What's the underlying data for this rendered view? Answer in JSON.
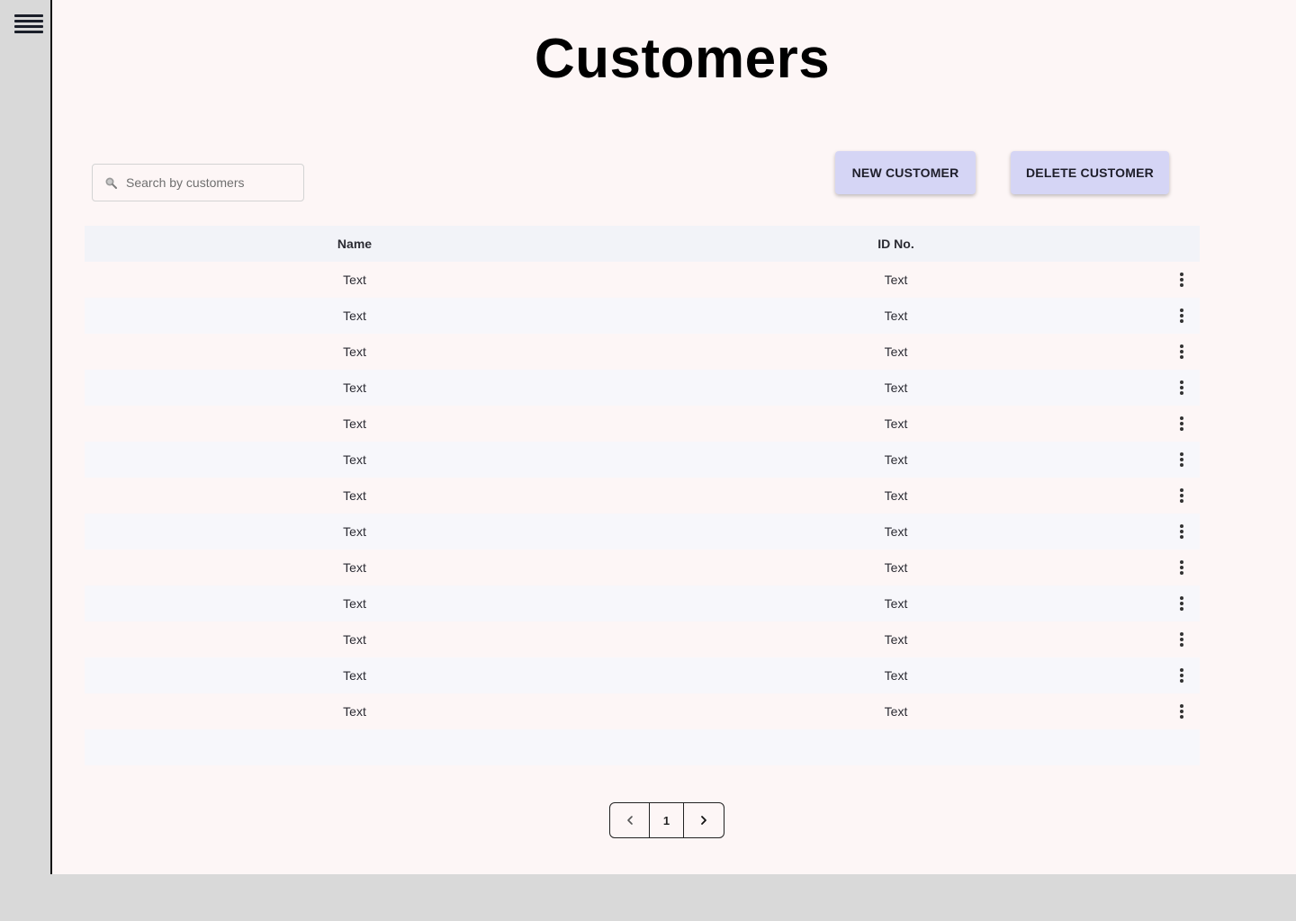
{
  "page": {
    "title": "Customers"
  },
  "search": {
    "placeholder": "Search by customers",
    "value": ""
  },
  "actions": {
    "new_label": "NEW CUSTOMER",
    "delete_label": "DELETE CUSTOMER"
  },
  "table": {
    "headers": {
      "name": "Name",
      "id": "ID No."
    },
    "rows": [
      {
        "name": "Text",
        "id": "Text"
      },
      {
        "name": "Text",
        "id": "Text"
      },
      {
        "name": "Text",
        "id": "Text"
      },
      {
        "name": "Text",
        "id": "Text"
      },
      {
        "name": "Text",
        "id": "Text"
      },
      {
        "name": "Text",
        "id": "Text"
      },
      {
        "name": "Text",
        "id": "Text"
      },
      {
        "name": "Text",
        "id": "Text"
      },
      {
        "name": "Text",
        "id": "Text"
      },
      {
        "name": "Text",
        "id": "Text"
      },
      {
        "name": "Text",
        "id": "Text"
      },
      {
        "name": "Text",
        "id": "Text"
      },
      {
        "name": "Text",
        "id": "Text"
      }
    ]
  },
  "pagination": {
    "current_page": "1"
  },
  "colors": {
    "accent_button": "#d5d5f5",
    "main_background": "#fdf6f6",
    "sidebar_background": "#d9d9d9"
  },
  "icons": {
    "menu": "hamburger-menu-icon",
    "search": "search-icon",
    "row_menu": "more-vertical-icon",
    "prev": "chevron-left-icon",
    "next": "chevron-right-icon"
  }
}
